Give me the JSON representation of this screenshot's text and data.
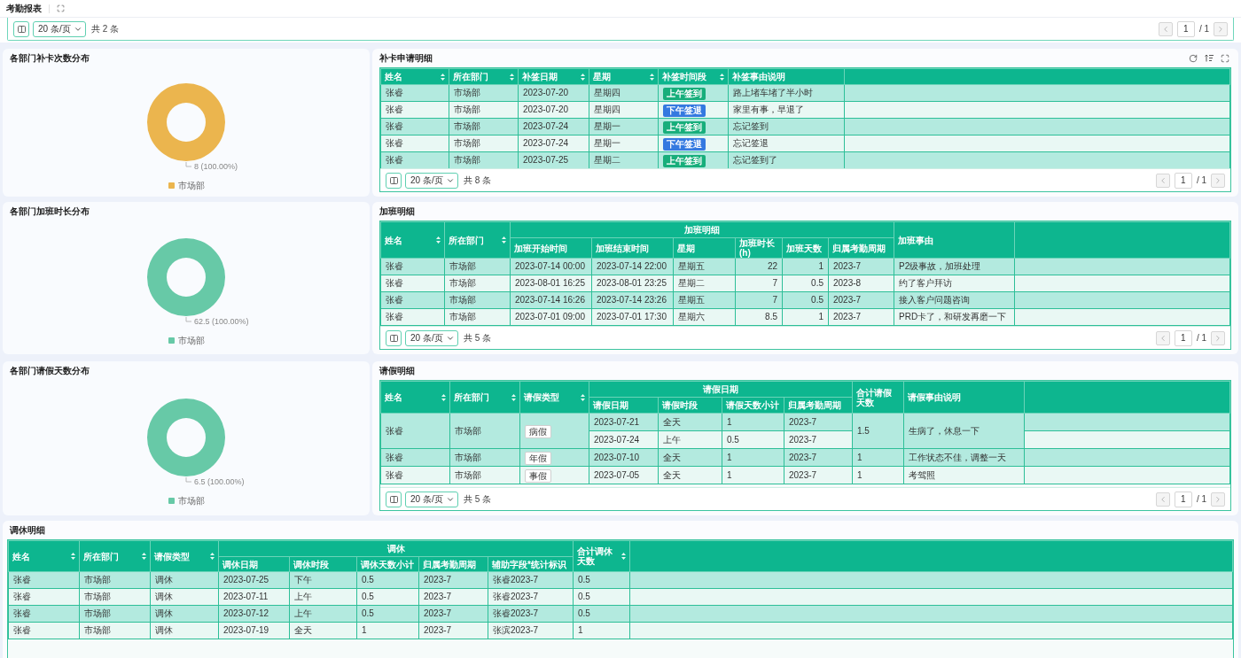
{
  "header": {
    "title": "考勤报表"
  },
  "top_pager": {
    "page_size": "20 条/页",
    "total": "共 2 条",
    "page": "1",
    "page_count": "/ 1"
  },
  "sections": [
    {
      "chart": {
        "title": "各部门补卡次数分布",
        "chart_data": {
          "type": "pie",
          "categories": [
            "市场部"
          ],
          "series": [
            {
              "color": "#ebb54e",
              "values": [
                100
              ]
            }
          ],
          "value_labels": [
            "8 (100.00%)"
          ]
        }
      },
      "table": {
        "title": "补卡申请明细",
        "columns": [
          {
            "label": "姓名",
            "kind": "text",
            "sortable": true
          },
          {
            "label": "所在部门",
            "kind": "text",
            "sortable": true
          },
          {
            "label": "补签日期",
            "kind": "text",
            "sortable": true
          },
          {
            "label": "星期",
            "kind": "text",
            "sortable": true
          },
          {
            "label": "补签时间段",
            "kind": "tag",
            "sortable": true
          },
          {
            "label": "补签事由说明",
            "kind": "text",
            "sortable": false
          }
        ],
        "rows": [
          {
            "cells": [
              "张睿",
              "市场部",
              "2023-07-20",
              "星期四",
              {
                "text": "上午签到",
                "color": "#17ae7b"
              },
              "路上堵车堵了半小时"
            ]
          },
          {
            "cells": [
              "张睿",
              "市场部",
              "2023-07-20",
              "星期四",
              {
                "text": "下午签退",
                "color": "#3479e0"
              },
              "家里有事，早退了"
            ]
          },
          {
            "cells": [
              "张睿",
              "市场部",
              "2023-07-24",
              "星期一",
              {
                "text": "上午签到",
                "color": "#17ae7b"
              },
              "忘记签到"
            ]
          },
          {
            "cells": [
              "张睿",
              "市场部",
              "2023-07-24",
              "星期一",
              {
                "text": "下午签退",
                "color": "#3479e0"
              },
              "忘记签退"
            ]
          },
          {
            "cells": [
              "张睿",
              "市场部",
              "2023-07-25",
              "星期二",
              {
                "text": "上午签到",
                "color": "#17ae7b"
              },
              "忘记签到了"
            ]
          }
        ],
        "pager": {
          "page_size": "20 条/页",
          "total": "共 8 条",
          "page": "1",
          "page_count": "/ 1"
        }
      }
    },
    {
      "chart": {
        "title": "各部门加班时长分布",
        "chart_data": {
          "type": "pie",
          "categories": [
            "市场部"
          ],
          "series": [
            {
              "color": "#67c9a7",
              "values": [
                100
              ]
            }
          ],
          "value_labels": [
            "62.5 (100.00%)"
          ]
        }
      },
      "table": {
        "title": "加班明细",
        "columns": [
          {
            "label": "姓名",
            "kind": "text",
            "sortable": true
          },
          {
            "label": "所在部门",
            "kind": "text",
            "sortable": true
          },
          {
            "label": "加班明细",
            "kind": "group",
            "sortable": false,
            "colspan": 6,
            "children": [
              {
                "label": "加班开始时间",
                "kind": "text",
                "sortable": false
              },
              {
                "label": "加班结束时间",
                "kind": "text",
                "sortable": false
              },
              {
                "label": "星期",
                "kind": "text",
                "sortable": false
              },
              {
                "label": "加班时长(h)",
                "kind": "number",
                "sortable": false
              },
              {
                "label": "加班天数",
                "kind": "number",
                "sortable": false
              },
              {
                "label": "归属考勤周期",
                "kind": "text",
                "sortable": false
              }
            ]
          },
          {
            "label": "加班事由",
            "kind": "text",
            "sortable": false
          }
        ],
        "rows": [
          {
            "cells": [
              "张睿",
              "市场部",
              "2023-07-14 00:00",
              "2023-07-14 22:00",
              "星期五",
              "22",
              "1",
              "2023-7",
              "P2级事故，加班处理"
            ]
          },
          {
            "cells": [
              "张睿",
              "市场部",
              "2023-08-01 16:25",
              "2023-08-01 23:25",
              "星期二",
              "7",
              "0.5",
              "2023-8",
              "约了客户拜访"
            ]
          },
          {
            "cells": [
              "张睿",
              "市场部",
              "2023-07-14 16:26",
              "2023-07-14 23:26",
              "星期五",
              "7",
              "0.5",
              "2023-7",
              "接入客户问题咨询"
            ]
          },
          {
            "cells": [
              "张睿",
              "市场部",
              "2023-07-01 09:00",
              "2023-07-01 17:30",
              "星期六",
              "8.5",
              "1",
              "2023-7",
              "PRD卡了，和研发再磨一下"
            ]
          }
        ],
        "pager": {
          "page_size": "20 条/页",
          "total": "共 5 条",
          "page": "1",
          "page_count": "/ 1"
        }
      }
    },
    {
      "chart": {
        "title": "各部门请假天数分布",
        "chart_data": {
          "type": "pie",
          "categories": [
            "市场部"
          ],
          "series": [
            {
              "color": "#67c9a7",
              "values": [
                100
              ]
            }
          ],
          "value_labels": [
            "6.5 (100.00%)"
          ]
        }
      },
      "table": {
        "title": "请假明细",
        "columns": [
          {
            "label": "姓名",
            "kind": "text",
            "sortable": true
          },
          {
            "label": "所在部门",
            "kind": "text",
            "sortable": true
          },
          {
            "label": "请假类型",
            "kind": "tag",
            "sortable": true
          },
          {
            "label": "请假日期",
            "kind": "group",
            "sortable": false,
            "colspan": 4,
            "children": [
              {
                "label": "请假日期",
                "kind": "text",
                "sortable": false
              },
              {
                "label": "请假时段",
                "kind": "text",
                "sortable": false
              },
              {
                "label": "请假天数小计",
                "kind": "text",
                "sortable": false
              },
              {
                "label": "归属考勤周期",
                "kind": "text",
                "sortable": false
              }
            ]
          },
          {
            "label": "合计请假天数",
            "kind": "text",
            "sortable": false
          },
          {
            "label": "请假事由说明",
            "kind": "text",
            "sortable": false
          }
        ],
        "rows": [
          {
            "cells": [
              {
                "text": "张睿",
                "rowspan": 2
              },
              {
                "text": "市场部",
                "rowspan": 2
              },
              {
                "text": "病假",
                "rowspan": 2
              },
              "2023-07-21",
              "全天",
              "1",
              "2023-7",
              {
                "text": "1.5",
                "rowspan": 2
              },
              {
                "text": "生病了，休息一下",
                "rowspan": 2
              }
            ]
          },
          {
            "cells": [
              "2023-07-24",
              "上午",
              "0.5",
              "2023-7"
            ]
          },
          {
            "cells": [
              "张睿",
              "市场部",
              "年假",
              "2023-07-10",
              "全天",
              "1",
              "2023-7",
              "1",
              "工作状态不佳，调整一天"
            ]
          },
          {
            "cells": [
              "张睿",
              "市场部",
              "事假",
              "2023-07-05",
              "全天",
              "1",
              "2023-7",
              "1",
              "考驾照"
            ]
          }
        ],
        "pager": {
          "page_size": "20 条/页",
          "total": "共 5 条",
          "page": "1",
          "page_count": "/ 1"
        }
      }
    }
  ],
  "compensatory_table": {
    "title": "调休明细",
    "columns": [
      {
        "label": "姓名",
        "kind": "text",
        "sortable": true
      },
      {
        "label": "所在部门",
        "kind": "text",
        "sortable": true
      },
      {
        "label": "请假类型",
        "kind": "text",
        "sortable": true
      },
      {
        "label": "调休",
        "kind": "group",
        "sortable": false,
        "colspan": 5,
        "children": [
          {
            "label": "调休日期",
            "kind": "text",
            "sortable": false
          },
          {
            "label": "调休时段",
            "kind": "text",
            "sortable": false
          },
          {
            "label": "调休天数小计",
            "kind": "text",
            "sortable": false
          },
          {
            "label": "归属考勤周期",
            "kind": "text",
            "sortable": false
          },
          {
            "label": "辅助字段*统计标识",
            "kind": "text",
            "sortable": false
          }
        ]
      },
      {
        "label": "合计调休天数",
        "kind": "text",
        "sortable": true
      }
    ],
    "rows": [
      {
        "cells": [
          "张睿",
          "市场部",
          "调休",
          "2023-07-25",
          "下午",
          "0.5",
          "2023-7",
          "张睿2023-7",
          "0.5"
        ]
      },
      {
        "cells": [
          "张睿",
          "市场部",
          "调休",
          "2023-07-11",
          "上午",
          "0.5",
          "2023-7",
          "张睿2023-7",
          "0.5"
        ]
      },
      {
        "cells": [
          "张睿",
          "市场部",
          "调休",
          "2023-07-12",
          "上午",
          "0.5",
          "2023-7",
          "张睿2023-7",
          "0.5"
        ]
      },
      {
        "cells": [
          "张睿",
          "市场部",
          "调休",
          "2023-07-19",
          "全天",
          "1",
          "2023-7",
          "张滨2023-7",
          "1"
        ]
      }
    ]
  }
}
